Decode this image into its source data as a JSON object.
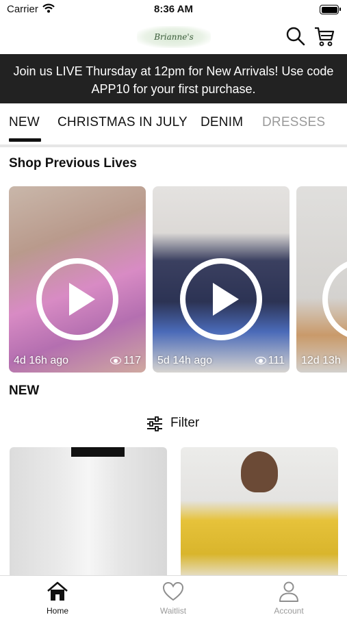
{
  "status_bar": {
    "carrier": "Carrier",
    "time": "8:36 AM"
  },
  "header": {
    "logo_text": "Brianne's Boutique",
    "icons": [
      "search-icon",
      "cart-icon"
    ]
  },
  "banner": {
    "text": "Join us LIVE Thursday at 12pm for New Arrivals! Use code APP10 for your first purchase."
  },
  "category_tabs": [
    "NEW",
    "CHRISTMAS IN JULY",
    "DENIM",
    "DRESSES"
  ],
  "sections": {
    "previous_lives_title": "Shop Previous Lives",
    "new_title": "NEW",
    "filter_label": "Filter"
  },
  "lives": [
    {
      "ago": "4d 16h ago",
      "views": "117"
    },
    {
      "ago": "5d 14h ago",
      "views": "111"
    },
    {
      "ago": "12d 13h",
      "views": ""
    }
  ],
  "tab_bar": [
    {
      "label": "Home",
      "icon": "home-icon",
      "active": true
    },
    {
      "label": "Waitlist",
      "icon": "heart-icon",
      "active": false
    },
    {
      "label": "Account",
      "icon": "person-icon",
      "active": false
    }
  ],
  "colors": {
    "banner_bg": "#222222",
    "active_tab": "#111111",
    "inactive_tabbar": "#9a9a9a"
  }
}
